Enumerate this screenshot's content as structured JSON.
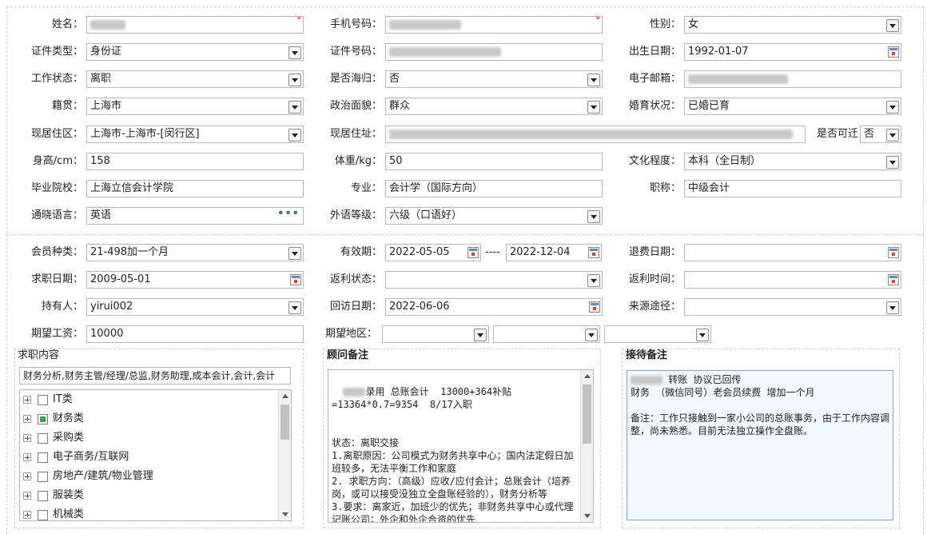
{
  "basic": {
    "name_label": "姓名：",
    "phone_label": "手机号码：",
    "gender_label": "性别：",
    "gender_value": "女",
    "id_type_label": "证件类型：",
    "id_type_value": "身份证",
    "id_no_label": "证件号码：",
    "birth_label": "出生日期：",
    "birth_value": "1992-01-07",
    "work_status_label": "工作状态：",
    "work_status_value": "离职",
    "overseas_label": "是否海归：",
    "overseas_value": "否",
    "email_label": "电子邮箱：",
    "native_label": "籍贯：",
    "native_value": "上海市",
    "politics_label": "政治面貌：",
    "politics_value": "群众",
    "marital_label": "婚育状况：",
    "marital_value": "已婚已育",
    "residence_area_label": "现居住区：",
    "residence_area_value": "上海市-上海市-[闵行区]",
    "residence_addr_label": "现居住址：",
    "relocate_label": "是否可迁",
    "relocate_value": "否",
    "height_label": "身高/cm：",
    "height_value": "158",
    "weight_label": "体重/kg：",
    "weight_value": "50",
    "education_label": "文化程度：",
    "education_value": "本科（全日制）",
    "school_label": "毕业院校：",
    "school_value": "上海立信会计学院",
    "major_label": "专业：",
    "major_value": "会计学（国际方向）",
    "title_label": "职称：",
    "title_value": "中级会计",
    "languages_label": "通晓语言：",
    "languages_value": "英语",
    "languages_more": "•••",
    "lang_level_label": "外语等级：",
    "lang_level_value": "六级（口语好）"
  },
  "membership": {
    "type_label": "会员种类：",
    "type_value": "21-498加一个月",
    "valid_label": "有效期：",
    "valid_from": "2022-05-05",
    "valid_sep": "----",
    "valid_to": "2022-12-04",
    "refund_date_label": "退费日期：",
    "job_date_label": "求职日期：",
    "job_date_value": "2009-05-01",
    "rebate_status_label": "返利状态：",
    "rebate_time_label": "返利时间：",
    "holder_label": "持有人：",
    "holder_value": "yirui002",
    "visit_date_label": "回访日期：",
    "visit_date_value": "2022-06-06",
    "source_label": "来源途径：",
    "salary_label": "期望工资：",
    "salary_value": "10000",
    "region_label": "期望地区："
  },
  "job_content": {
    "title": "求职内容",
    "summary": "财务分析,财务主管/经理/总监,财务助理,成本会计,会计,会计",
    "tree": [
      {
        "label": "IT类",
        "checked": false
      },
      {
        "label": "财务类",
        "checked": true
      },
      {
        "label": "采购类",
        "checked": false
      },
      {
        "label": "电子商务/互联网",
        "checked": false
      },
      {
        "label": "房地产/建筑/物业管理",
        "checked": false
      },
      {
        "label": "服装类",
        "checked": false
      },
      {
        "label": "机械类",
        "checked": false
      }
    ]
  },
  "advisor_note": {
    "title": "顾问备注",
    "text": "录用 总账会计  13000+364补贴\n=13364*0.7=9354  8/17入职\n\n\n状态：离职交接\n1.离职原因：公司模式为财务共享中心；国内法定假日加班较多，无法平衡工作和家庭\n2. 求职方向：（高级）应收/应付会计；总账会计（培养岗，或可以接受没独立全盘账经验的），财务分析等\n3.要求：离家近，加班少的优先；非财务共享中心或代理记账公司；外企和外企合资的优先"
  },
  "reception_note": {
    "title": "接待备注",
    "text": "转账 协议已回传\n财务 （微信同号）老会员续费 增加一个月\n\n备注：工作只接触到一家小公司的总账事务，由于工作内容调整，尚未熟悉。目前无法独立操作全盘账。"
  }
}
